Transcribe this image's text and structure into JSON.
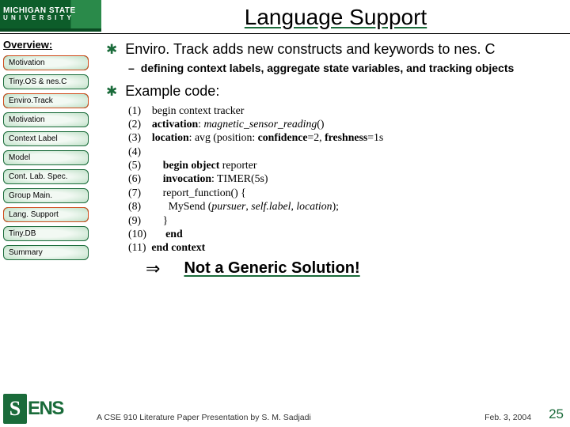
{
  "logo": {
    "line1": "MICHIGAN STATE",
    "line2": "U N I V E R S I T Y"
  },
  "title": "Language Support",
  "sidebar": {
    "heading": "Overview:",
    "items": [
      {
        "label": "Motivation",
        "on": true
      },
      {
        "label": "Tiny.OS & nes.C",
        "on": false
      },
      {
        "label": "Enviro.Track",
        "on": true
      },
      {
        "label": "Motivation",
        "on": false
      },
      {
        "label": "Context Label",
        "on": false
      },
      {
        "label": "Model",
        "on": false
      },
      {
        "label": "Cont. Lab. Spec.",
        "on": false
      },
      {
        "label": "Group Main.",
        "on": false
      },
      {
        "label": "Lang. Support",
        "on": true
      },
      {
        "label": "Tiny.DB",
        "on": false
      },
      {
        "label": "Summary",
        "on": false
      }
    ]
  },
  "content": {
    "b1": "Enviro. Track adds new constructs and keywords to nes. C",
    "s1": "defining context labels, aggregate state variables, and tracking objects",
    "b2": "Example code:",
    "conclusion": "Not a Generic Solution!"
  },
  "code": {
    "l1": "(1)    begin context tracker",
    "l2": "(2)    activation: 𝑚𝑎𝑔𝑛𝑒𝑡𝑖𝑐_𝑠𝑒𝑛𝑠𝑜𝑟_𝑟𝑒𝑎𝑑𝑖𝑛𝑔()",
    "l3": "(3)    location: avg (position: confidence=2, freshness=1s",
    "l4": "(4)",
    "l5": "(5)        begin object reporter",
    "l6": "(6)        invocation: TIMER(5s)",
    "l7": "(7)        report_function() {",
    "l8": "(8)          MySend (𝑝𝑢𝑟𝑠𝑢𝑒𝑟, 𝑠𝑒𝑙𝑓.𝑙𝑎𝑏𝑒𝑙, 𝑙𝑜𝑐𝑎𝑡𝑖𝑜𝑛);",
    "l9": "(9)        }",
    "l10": "(10)       end",
    "l11": "(11)  end context"
  },
  "footer": {
    "text": "A CSE 910 Literature Paper Presentation by S. M. Sadjadi",
    "date": "Feb. 3, 2004",
    "page": "25",
    "sens": "ENS"
  }
}
